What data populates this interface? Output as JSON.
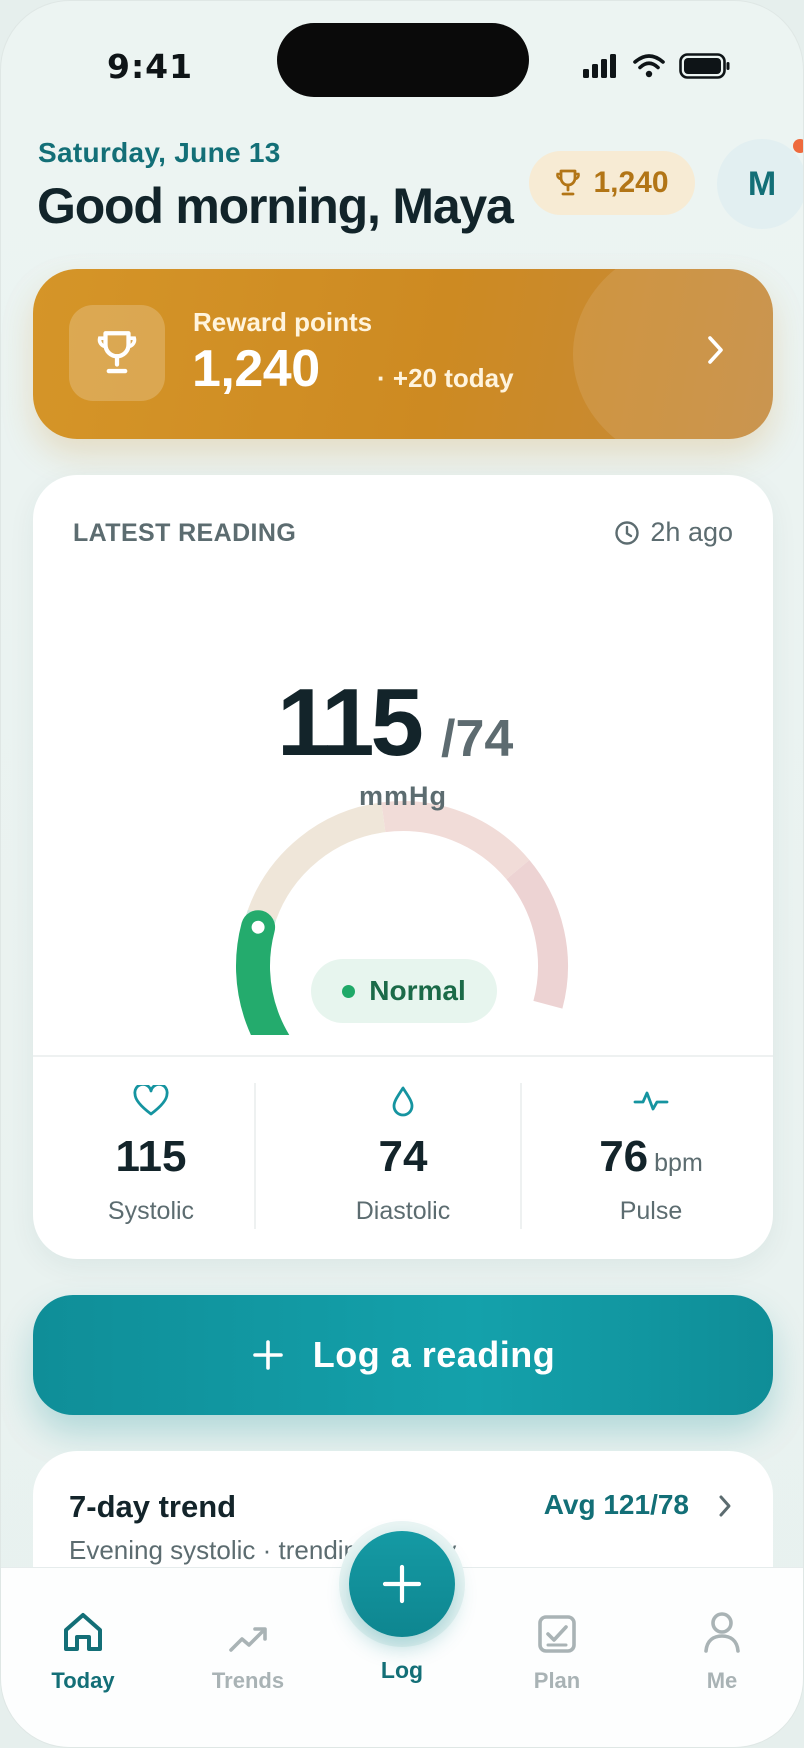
{
  "status_bar": {
    "time": "9:41"
  },
  "header": {
    "date": "Saturday, June 13",
    "greeting": "Good morning, Maya",
    "points_chip": "1,240",
    "avatar_initial": "M"
  },
  "reward_card": {
    "label": "Reward points",
    "value": "1,240",
    "today": "· +20 today"
  },
  "reading_card": {
    "label": "LATEST READING",
    "time_ago": "2h ago",
    "systolic_big": "115",
    "diastolic_big": "/74",
    "unit": "mmHg",
    "status": "Normal",
    "gauge_level": 0.28,
    "metrics": [
      {
        "value": "115",
        "unit": "",
        "label": "Systolic"
      },
      {
        "value": "74",
        "unit": "",
        "label": "Diastolic"
      },
      {
        "value": "76",
        "unit": "bpm",
        "label": "Pulse"
      }
    ]
  },
  "log_button": {
    "label": "Log a reading"
  },
  "trend_card": {
    "title": "7-day trend",
    "subtitle": "Evening systolic · trending steady",
    "average": "Avg 121/78"
  },
  "tabbar": {
    "tabs": [
      {
        "label": "Today"
      },
      {
        "label": "Trends"
      },
      {
        "label": "Log"
      },
      {
        "label": "Plan"
      },
      {
        "label": "Me"
      }
    ]
  },
  "colors": {
    "accent": "#136f77",
    "reward": "#d5952a",
    "normal": "#1fa968",
    "alert": "#ee6a3d"
  }
}
